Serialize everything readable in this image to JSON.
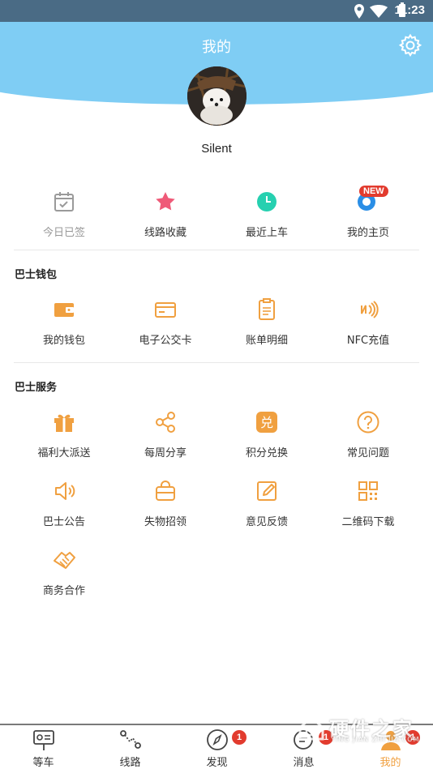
{
  "status_bar": {
    "time": "11:23"
  },
  "header": {
    "title": "我的"
  },
  "profile": {
    "username": "Silent"
  },
  "quick_actions": [
    {
      "label": "今日已签",
      "icon": "calendar-check-icon"
    },
    {
      "label": "线路收藏",
      "icon": "star-icon"
    },
    {
      "label": "最近上车",
      "icon": "clock-icon"
    },
    {
      "label": "我的主页",
      "icon": "homepage-icon",
      "badge": "NEW"
    }
  ],
  "wallet": {
    "title": "巴士钱包",
    "items": [
      {
        "label": "我的钱包",
        "icon": "wallet-icon"
      },
      {
        "label": "电子公交卡",
        "icon": "bus-card-icon"
      },
      {
        "label": "账单明细",
        "icon": "bill-icon"
      },
      {
        "label": "NFC充值",
        "icon": "nfc-icon"
      }
    ]
  },
  "services": {
    "title": "巴士服务",
    "items": [
      {
        "label": "福利大派送",
        "icon": "gift-icon"
      },
      {
        "label": "每周分享",
        "icon": "share-icon"
      },
      {
        "label": "积分兑换",
        "icon": "exchange-icon",
        "glyph": "兑"
      },
      {
        "label": "常见问题",
        "icon": "question-icon"
      },
      {
        "label": "巴士公告",
        "icon": "speaker-icon"
      },
      {
        "label": "失物招领",
        "icon": "bag-icon"
      },
      {
        "label": "意见反馈",
        "icon": "edit-icon"
      },
      {
        "label": "二维码下载",
        "icon": "qrcode-icon"
      },
      {
        "label": "商务合作",
        "icon": "handshake-icon"
      }
    ]
  },
  "tabbar": {
    "items": [
      {
        "label": "等车",
        "icon": "bus-stop-icon"
      },
      {
        "label": "线路",
        "icon": "route-icon"
      },
      {
        "label": "发现",
        "icon": "compass-icon",
        "badge": "1"
      },
      {
        "label": "消息",
        "icon": "message-icon",
        "badge": "1"
      },
      {
        "label": "我的",
        "icon": "person-icon",
        "badge": "1",
        "active": true
      }
    ]
  },
  "watermark": {
    "title": "硬件之家",
    "subtitle": "YING JIAN ZHI JIA.COM"
  },
  "colors": {
    "header": "#7fcdf4",
    "accent": "#f0a040",
    "badge": "#e23b2e",
    "star": "#ef5a78",
    "teal": "#26d0b0"
  }
}
